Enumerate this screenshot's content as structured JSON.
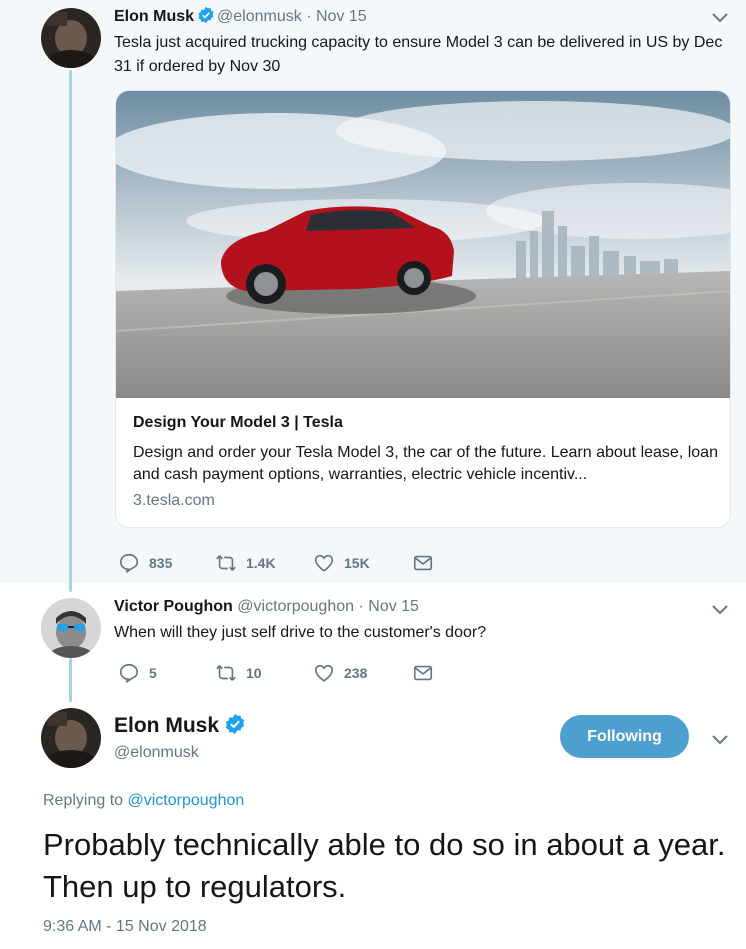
{
  "tweet1": {
    "name": "Elon Musk",
    "handle": "@elonmusk",
    "date": "· Nov 15",
    "text": "Tesla just acquired trucking capacity to ensure Model 3 can be delivered in US by Dec 31 if ordered by Nov 30",
    "card": {
      "title": "Design Your Model 3 | Tesla",
      "description": "Design and order your Tesla Model 3, the car of the future. Learn about lease, loan and cash payment options, warranties, electric vehicle incentiv...",
      "url": "3.tesla.com"
    },
    "actions": {
      "replies": "835",
      "retweets": "1.4K",
      "likes": "15K"
    }
  },
  "tweet2": {
    "name": "Victor Poughon",
    "handle": "@victorpoughon",
    "date": "· Nov 15",
    "text": "When will they just self drive to the customer's door?",
    "actions": {
      "replies": "5",
      "retweets": "10",
      "likes": "238"
    }
  },
  "main_tweet": {
    "name": "Elon Musk",
    "handle": "@elonmusk",
    "follow_label": "Following",
    "replying_prefix": "Replying to",
    "replying_to": "@victorpoughon",
    "text": "Probably technically able to do so in about a year. Then up to regulators.",
    "timestamp": "9:36 AM - 15 Nov 2018"
  },
  "colors": {
    "accent": "#1da1f2",
    "follow_button": "#4c9fcf",
    "thread_line": "#a6d5e2",
    "muted": "#657786"
  },
  "icons": [
    "reply-icon",
    "retweet-icon",
    "like-icon",
    "direct-message-icon",
    "verified-badge-icon",
    "chevron-down-icon"
  ]
}
